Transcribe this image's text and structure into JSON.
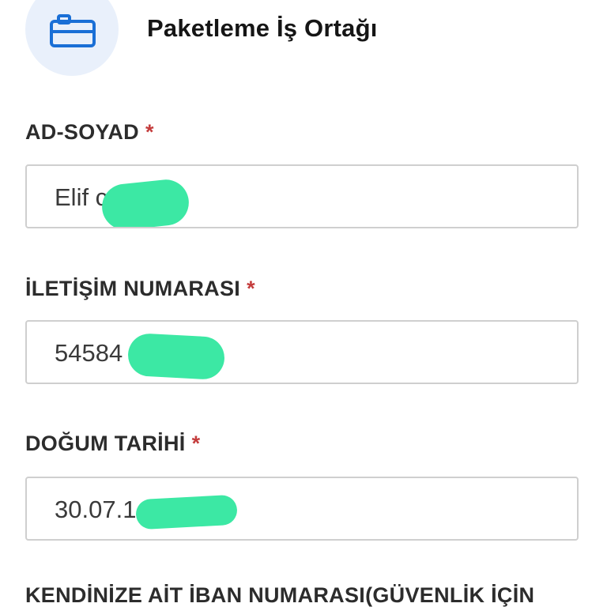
{
  "header": {
    "icon": "briefcase-icon",
    "title": "Paketleme İş Ortağı"
  },
  "colors": {
    "accent": "#1a6fd6",
    "icon_bg": "#e9f0fb",
    "required": "#c43c3c",
    "redaction": "#3ce8a4"
  },
  "fields": [
    {
      "label": "AD-SOYAD",
      "required_mark": "*",
      "value": "Elif c"
    },
    {
      "label": "İLETİŞİM NUMARASI",
      "required_mark": "*",
      "value": "54584"
    },
    {
      "label": "DOĞUM TARİHİ",
      "required_mark": "*",
      "value": "30.07.1"
    },
    {
      "label": "KENDİNİZE AİT İBAN NUMARASI(GÜVENLİK İÇİN"
    }
  ]
}
